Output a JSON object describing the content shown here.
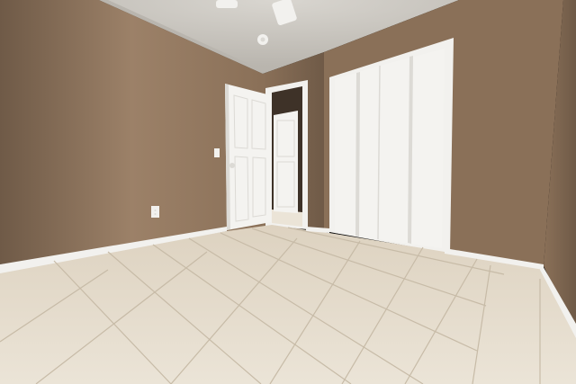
{
  "scene": {
    "subject": "empty-bedroom",
    "elements": [
      "ceiling",
      "ceiling-fan",
      "smoke-detector",
      "left-wall",
      "back-wall",
      "right-wall",
      "interior-door",
      "hallway-door",
      "bifold-closet",
      "light-switch",
      "power-outlet",
      "baseboards",
      "tile-floor"
    ],
    "colors": {
      "wall_main": "#8a7058",
      "wall_shadow": "#6f5a47",
      "wall_light": "#9c8168",
      "ceiling": "#d9d6d0",
      "ceiling_shadow": "#b9b5ae",
      "trim": "#f2f1ee",
      "door": "#f4f3f0",
      "door_shade": "#dcdad5",
      "floor": "#ddd2c0",
      "floor_light": "#ebe4d7",
      "grout": "#c7bba7",
      "hall_dark": "#3e3228"
    }
  }
}
